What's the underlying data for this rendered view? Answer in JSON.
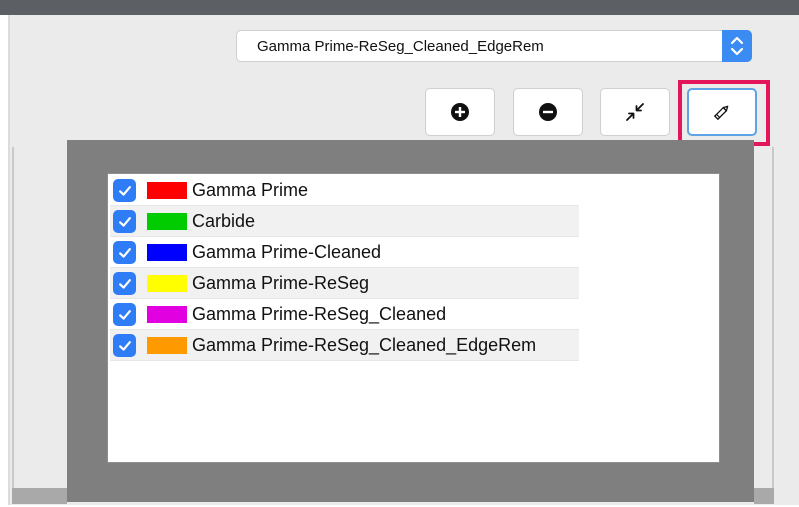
{
  "toolbar": {
    "dataset_select": {
      "value": "Gamma Prime-ReSeg_Cleaned_EdgeRem",
      "icon": "updown-chevron-icon",
      "accent": "#3a8bf2"
    },
    "buttons": [
      {
        "name": "zoom-in-button",
        "icon": "plus-circle-icon"
      },
      {
        "name": "zoom-out-button",
        "icon": "minus-circle-icon"
      },
      {
        "name": "fit-view-button",
        "icon": "collapse-arrows-icon"
      },
      {
        "name": "edit-button",
        "icon": "pencil-icon",
        "highlighted": true,
        "highlight_color": "#e3165b"
      }
    ]
  },
  "layers": {
    "items": [
      {
        "label": "Gamma Prime",
        "color": "#ff0000",
        "checked": true
      },
      {
        "label": "Carbide",
        "color": "#00cc00",
        "checked": true
      },
      {
        "label": "Gamma Prime-Cleaned",
        "color": "#0000ff",
        "checked": true
      },
      {
        "label": "Gamma Prime-ReSeg",
        "color": "#ffff00",
        "checked": true
      },
      {
        "label": "Gamma Prime-ReSeg_Cleaned",
        "color": "#e000e0",
        "checked": true
      },
      {
        "label": "Gamma Prime-ReSeg_Cleaned_EdgeRem",
        "color": "#ff9900",
        "checked": true
      }
    ]
  }
}
